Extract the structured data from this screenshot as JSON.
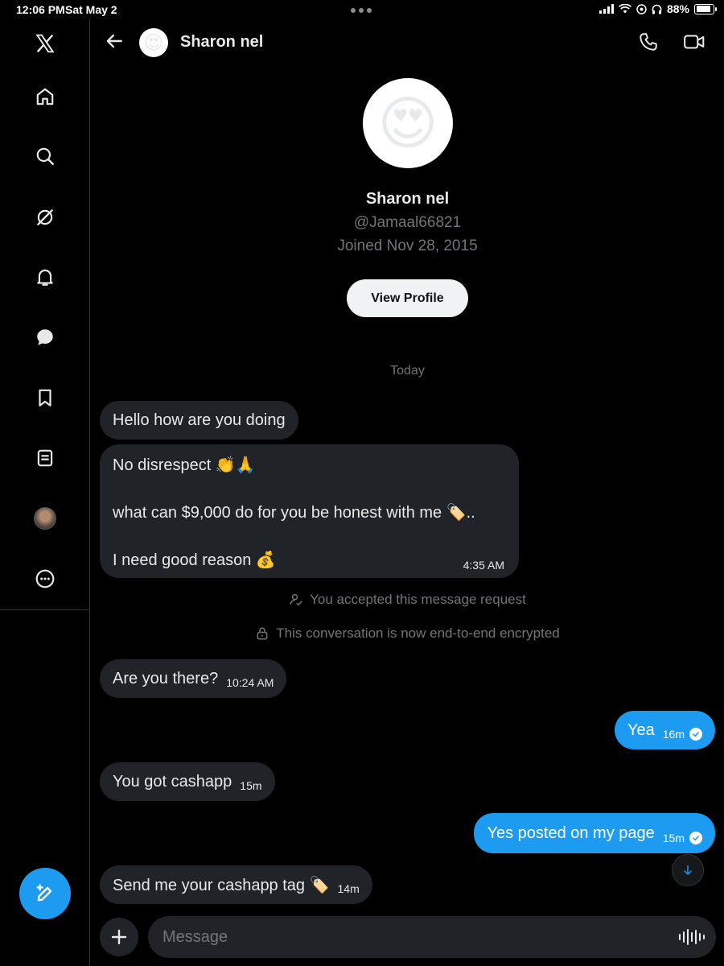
{
  "status_bar": {
    "time": "12:06 PM",
    "date": "Sat May 2",
    "battery": "88%",
    "battery_level": 0.88
  },
  "header": {
    "name": "Sharon nel",
    "avatar_emoji": "😍"
  },
  "profile": {
    "avatar_emoji": "😍",
    "name": "Sharon nel",
    "handle": "@Jamaal66821",
    "joined": "Joined Nov 28, 2015",
    "view_button": "View Profile"
  },
  "day_separator": "Today",
  "messages": {
    "m1": {
      "text": "Hello how are you doing"
    },
    "m2": {
      "line1": "No disrespect 👏🙏",
      "line2": "what can $9,000 do for you be honest with me 🏷️..",
      "line3": "I need good reason  💰",
      "time": "4:35 AM"
    },
    "sys1": "You accepted this message request",
    "sys2": "This conversation is now end-to-end encrypted",
    "m3": {
      "text": "Are you there?",
      "time": "10:24 AM"
    },
    "m4": {
      "text": "Yea",
      "time": "16m"
    },
    "m5": {
      "text": "You got cashapp",
      "time": "15m"
    },
    "m6": {
      "text": "Yes posted on my page",
      "time": "15m"
    },
    "m7": {
      "text": "Send me your cashapp tag 🏷️",
      "time": "14m"
    }
  },
  "composer": {
    "placeholder": "Message"
  },
  "colors": {
    "accent": "#1d9bf0",
    "incoming_bubble": "#202327",
    "muted": "#71767b"
  }
}
